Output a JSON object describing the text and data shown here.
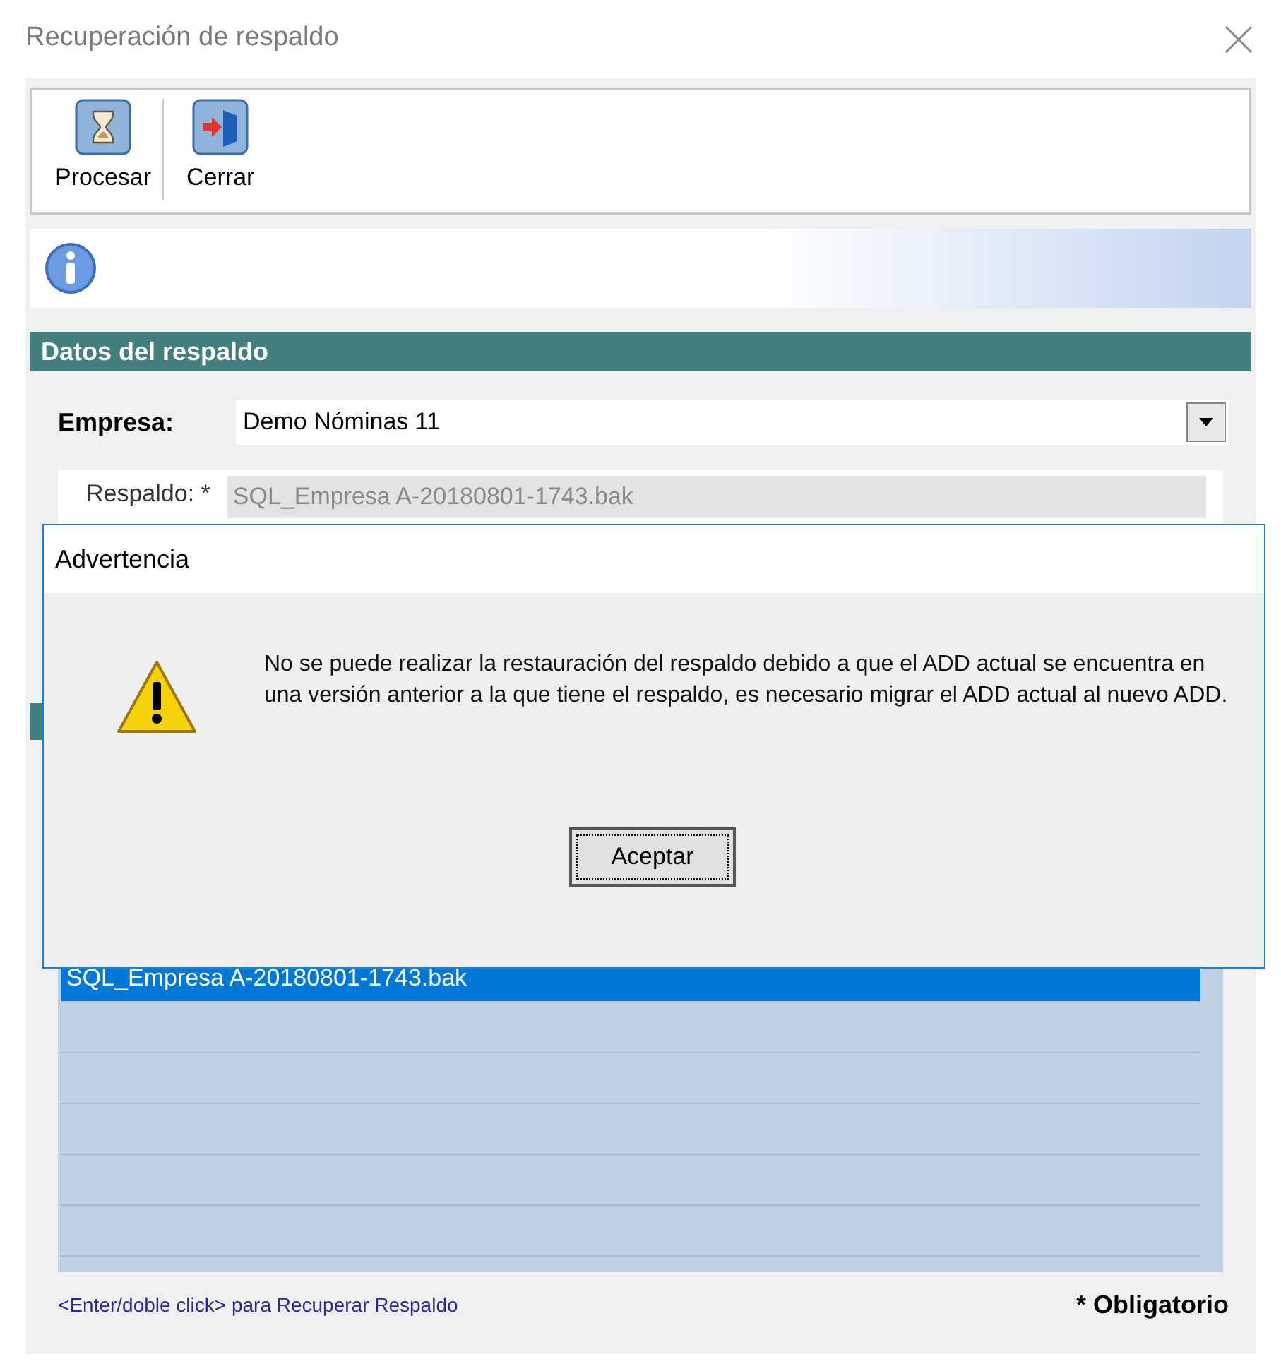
{
  "window": {
    "title": "Recuperación de respaldo"
  },
  "toolbar": [
    {
      "label": "Procesar",
      "kind": "hourglass"
    },
    {
      "label": "Cerrar",
      "kind": "exit"
    }
  ],
  "section": {
    "title": "Datos del respaldo"
  },
  "empresa": {
    "label": "Empresa:",
    "value": "Demo Nóminas 11"
  },
  "respaldo": {
    "label": "Respaldo: *",
    "value": "SQL_Empresa A-20180801-1743.bak"
  },
  "backups": [
    {
      "name": "SQL_Empresa A-20180801-1743.bak",
      "selected": true
    }
  ],
  "hint": "<Enter/doble click> para Recuperar Respaldo",
  "required_note": "* Obligatorio",
  "dialog": {
    "title": "Advertencia",
    "message": "No se puede realizar la restauración del respaldo debido a que el ADD actual se encuentra en una versión anterior a la que tiene el respaldo, es necesario migrar el ADD actual al nuevo ADD.",
    "button": "Aceptar"
  }
}
